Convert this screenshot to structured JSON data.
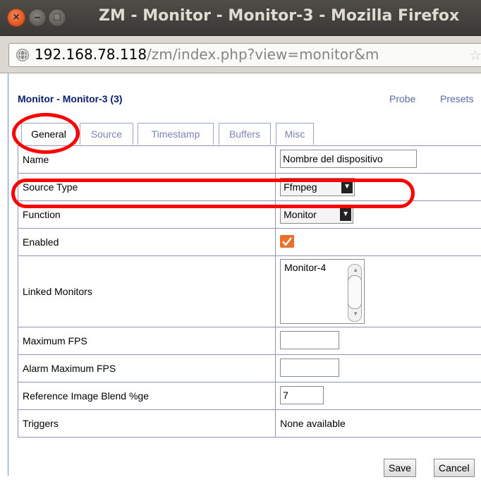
{
  "window": {
    "title": "ZM - Monitor - Monitor-3 - Mozilla Firefox",
    "buttons": {
      "close_glyph": "×",
      "minimize_glyph": "–",
      "maximize_glyph": "□"
    }
  },
  "urlbar": {
    "host": "192.168.78.118",
    "path": "/zm/index.php?view=monitor&m",
    "icon": "globe-icon",
    "star_glyph": "☆"
  },
  "page": {
    "heading": "Monitor - Monitor-3 (3)",
    "links": {
      "probe": "Probe",
      "presets": "Presets"
    },
    "tabs": [
      "General",
      "Source",
      "Timestamp",
      "Buffers",
      "Misc"
    ],
    "active_tab": "General",
    "rows": {
      "name": {
        "label": "Name",
        "value": "Nombre del dispositivo"
      },
      "source_type": {
        "label": "Source Type",
        "value": "Ffmpeg"
      },
      "function": {
        "label": "Function",
        "value": "Monitor"
      },
      "enabled": {
        "label": "Enabled",
        "checked": true
      },
      "linked_monitors": {
        "label": "Linked Monitors",
        "options": [
          "Monitor-4"
        ]
      },
      "max_fps": {
        "label": "Maximum FPS",
        "value": ""
      },
      "alarm_max_fps": {
        "label": "Alarm Maximum FPS",
        "value": ""
      },
      "ref_blend": {
        "label": "Reference Image Blend %ge",
        "value": "7"
      },
      "triggers": {
        "label": "Triggers",
        "value": "None available"
      }
    },
    "buttons": {
      "save": "Save",
      "cancel": "Cancel"
    }
  },
  "annotations": {
    "color": "#ff0000"
  }
}
